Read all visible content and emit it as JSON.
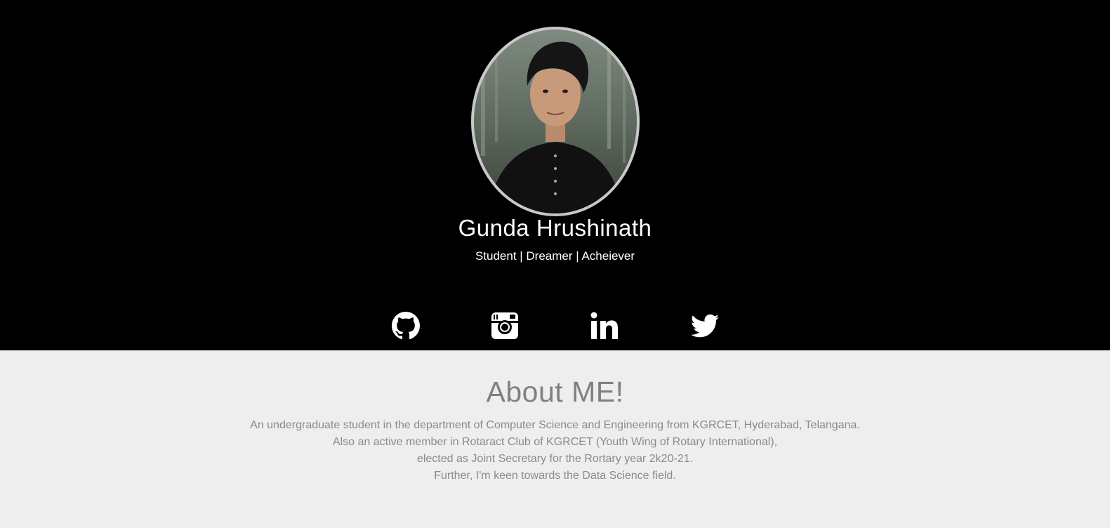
{
  "profile": {
    "name": "Gunda Hrushinath",
    "tagline": "Student | Dreamer | Acheiever",
    "photo_alt": "profile photo"
  },
  "social": [
    {
      "icon": "github-icon",
      "label": "GitHub"
    },
    {
      "icon": "instagram-icon",
      "label": "Instagram"
    },
    {
      "icon": "linkedin-icon",
      "label": "LinkedIn"
    },
    {
      "icon": "twitter-icon",
      "label": "Twitter"
    }
  ],
  "about": {
    "title": "About ME!",
    "lines": [
      "An undergraduate student in the department of Computer Science and Engineering from KGRCET, Hyderabad, Telangana.",
      "Also an active member in Rotaract Club of KGRCET (Youth Wing of Rotary International),",
      "elected as Joint Secretary for the Rortary year 2k20-21.",
      "Further, I'm keen towards the Data Science field."
    ]
  },
  "colors": {
    "hero_bg": "#000000",
    "about_bg": "#eeeeee",
    "about_text": "#8a8a8a",
    "avatar_border": "#c8c8c8"
  }
}
